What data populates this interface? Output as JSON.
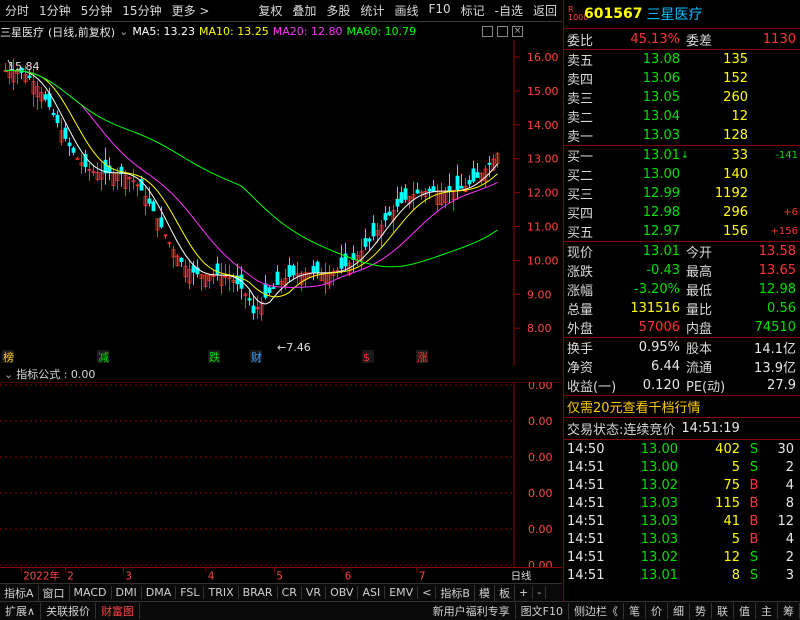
{
  "toolbar": {
    "left": [
      "分时",
      "1分钟",
      "5分钟",
      "15分钟",
      "更多 >"
    ],
    "right": [
      "复权",
      "叠加",
      "多股",
      "统计",
      "画线",
      "F10",
      "标记",
      "-自选",
      "返回"
    ]
  },
  "chart_header": {
    "stock_name": "三星医疗",
    "period": "(日线,前复权)",
    "ma5": "MA5: 13.23",
    "ma10": "MA10: 13.25",
    "ma20": "MA20: 12.80",
    "ma60": "MA60: 10.79"
  },
  "colors": {
    "ma5": "#ffffff",
    "ma10": "#ffff00",
    "ma20": "#ff33ff",
    "ma60": "#00ff00",
    "up": "#ff3333",
    "down": "#00ffff",
    "grid": "#8b0000"
  },
  "price_axis": [
    "16.00",
    "15.00",
    "14.00",
    "13.00",
    "12.00",
    "11.00",
    "10.00",
    "9.00",
    "8.00"
  ],
  "annotations": {
    "high": "15.84",
    "low": "←7.46"
  },
  "event_marks": [
    {
      "label": "榜",
      "color": "#ffcc00"
    },
    {
      "label": "减",
      "color": "#00dd00"
    },
    {
      "label": "跌",
      "color": "#00dd00"
    },
    {
      "label": "财",
      "color": "#3399ff"
    },
    {
      "label": "$",
      "color": "#ff3333"
    },
    {
      "label": "涨",
      "color": "#ff3333"
    }
  ],
  "indicator": {
    "label": "指标公式 : 0.00",
    "axis": [
      "0.00",
      "0.00",
      "0.00",
      "0.00",
      "0.00",
      "0.00"
    ]
  },
  "date_axis": {
    "labels": [
      "2022年",
      "2",
      "3",
      "4",
      "5",
      "6",
      "7"
    ],
    "period": "日线"
  },
  "bottom_tabs": [
    "指标A",
    "窗口",
    "MACD",
    "DMI",
    "DMA",
    "FSL",
    "TRIX",
    "BRAR",
    "CR",
    "VR",
    "OBV",
    "ASI",
    "EMV",
    "<",
    "指标B",
    "模",
    "板",
    "+",
    "-"
  ],
  "bottom_bar_left": [
    "扩展∧",
    "关联报价",
    "财富图"
  ],
  "bottom_bar_mid": [
    "新用户福利专享",
    "图文F10",
    "侧边栏《"
  ],
  "bottom_bar_right": [
    "笔",
    "价",
    "细",
    "势",
    "联",
    "值",
    "主",
    "筹"
  ],
  "quote": {
    "code": "601567",
    "name": "三星医疗",
    "weibi_label": "委比",
    "weibi": "45.13%",
    "weicha_label": "委差",
    "weicha": "1130",
    "sell": [
      {
        "label": "卖五",
        "price": "13.08",
        "vol": "135"
      },
      {
        "label": "卖四",
        "price": "13.06",
        "vol": "152"
      },
      {
        "label": "卖三",
        "price": "13.05",
        "vol": "260"
      },
      {
        "label": "卖二",
        "price": "13.04",
        "vol": "12"
      },
      {
        "label": "卖一",
        "price": "13.03",
        "vol": "128"
      }
    ],
    "buy": [
      {
        "label": "买一",
        "price": "13.01",
        "vol": "33",
        "chg": "-141"
      },
      {
        "label": "买二",
        "price": "13.00",
        "vol": "140",
        "chg": ""
      },
      {
        "label": "买三",
        "price": "12.99",
        "vol": "1192",
        "chg": ""
      },
      {
        "label": "买四",
        "price": "12.98",
        "vol": "296",
        "chg": "+6"
      },
      {
        "label": "买五",
        "price": "12.97",
        "vol": "156",
        "chg": "+156"
      }
    ],
    "stats": [
      {
        "l1": "现价",
        "v1": "13.01",
        "c1": "green",
        "l2": "今开",
        "v2": "13.58",
        "c2": "red"
      },
      {
        "l1": "涨跌",
        "v1": "-0.43",
        "c1": "green",
        "l2": "最高",
        "v2": "13.65",
        "c2": "red"
      },
      {
        "l1": "涨幅",
        "v1": "-3.20%",
        "c1": "green",
        "l2": "最低",
        "v2": "12.98",
        "c2": "green"
      },
      {
        "l1": "总量",
        "v1": "131516",
        "c1": "yellow",
        "l2": "量比",
        "v2": "0.56",
        "c2": "green"
      },
      {
        "l1": "外盘",
        "v1": "57006",
        "c1": "red",
        "l2": "内盘",
        "v2": "74510",
        "c2": "green"
      }
    ],
    "stats2": [
      {
        "l1": "换手",
        "v1": "0.95%",
        "l2": "股本",
        "v2": "14.1亿"
      },
      {
        "l1": "净资",
        "v1": "6.44",
        "l2": "流通",
        "v2": "13.9亿"
      },
      {
        "l1": "收益(一)",
        "v1": "0.120",
        "l2": "PE(动)",
        "v2": "27.9"
      }
    ],
    "promo": "仅需20元查看千档行情",
    "status_label": "交易状态:",
    "status": "连续竞价",
    "status_time": "14:51:19",
    "ticks": [
      {
        "time": "14:50",
        "price": "13.00",
        "vol": "402",
        "bs": "S",
        "n": "30"
      },
      {
        "time": "14:51",
        "price": "13.00",
        "vol": "5",
        "bs": "S",
        "n": "2"
      },
      {
        "time": "14:51",
        "price": "13.02",
        "vol": "75",
        "bs": "B",
        "n": "4"
      },
      {
        "time": "14:51",
        "price": "13.03",
        "vol": "115",
        "bs": "B",
        "n": "8"
      },
      {
        "time": "14:51",
        "price": "13.03",
        "vol": "41",
        "bs": "B",
        "n": "12"
      },
      {
        "time": "14:51",
        "price": "13.03",
        "vol": "5",
        "bs": "B",
        "n": "4"
      },
      {
        "time": "14:51",
        "price": "13.02",
        "vol": "12",
        "bs": "S",
        "n": "2"
      },
      {
        "time": "14:51",
        "price": "13.01",
        "vol": "8",
        "bs": "S",
        "n": "3"
      }
    ]
  }
}
